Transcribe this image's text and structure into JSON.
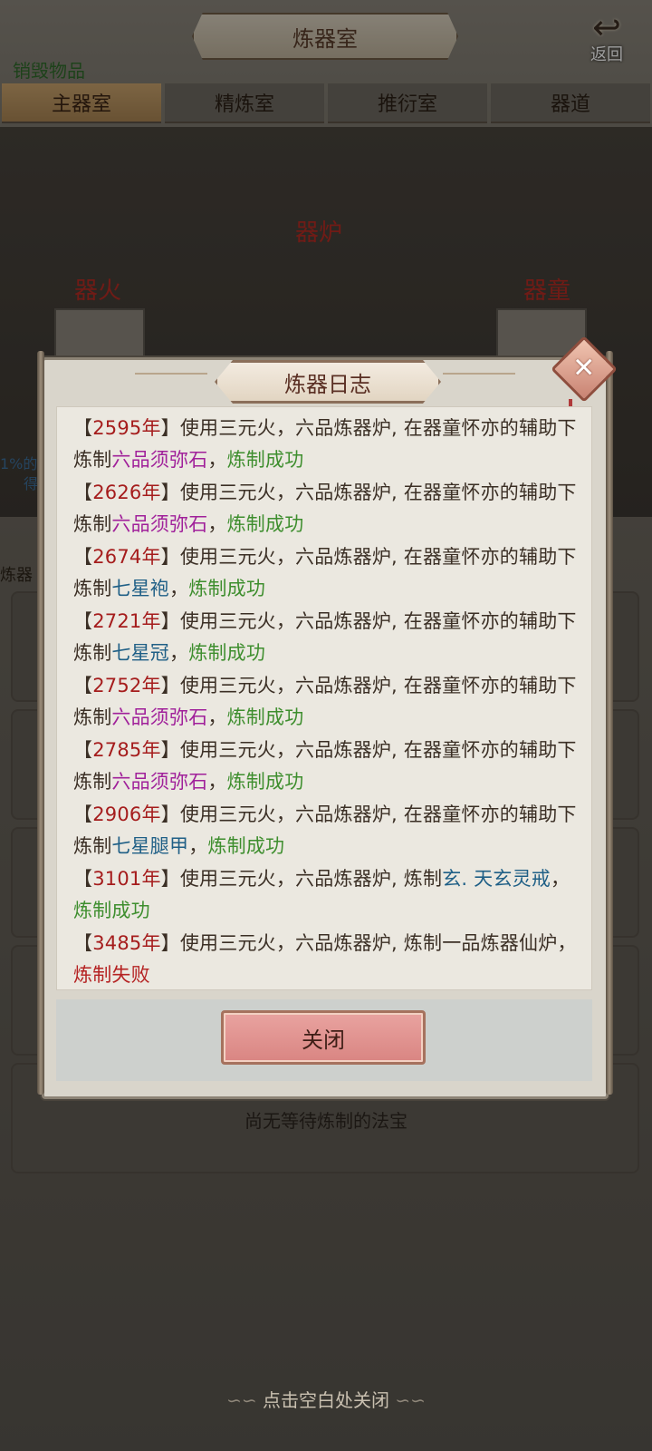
{
  "header": {
    "title": "炼器室",
    "back_label": "返回",
    "back_arrow": "↩",
    "destroy_link": "销毁物品"
  },
  "tabs": [
    {
      "label": "主器室",
      "active": true
    },
    {
      "label": "精炼室",
      "active": false
    },
    {
      "label": "推衍室",
      "active": false
    },
    {
      "label": "器道",
      "active": false
    }
  ],
  "stage": {
    "furnace_label": "器炉",
    "fire_label": "器火",
    "servant_label": "器童",
    "side_text": "1%的",
    "side_text2": "得",
    "list_title": "炼器"
  },
  "empty_hint": "尚无等待炼制的法宝",
  "tap_close": "点击空白处关闭",
  "dialog": {
    "title": "炼器日志",
    "close_icon": "✕",
    "close_button": "关闭",
    "entries": [
      {
        "year": "2595年",
        "text": "使用三元火，六品炼器炉, 在器童怀亦的辅助下炼制",
        "item": "六品须弥石",
        "item_color": "purple",
        "result": "炼制成功",
        "result_type": "success"
      },
      {
        "year": "2626年",
        "text": "使用三元火，六品炼器炉, 在器童怀亦的辅助下炼制",
        "item": "六品须弥石",
        "item_color": "purple",
        "result": "炼制成功",
        "result_type": "success"
      },
      {
        "year": "2674年",
        "text": "使用三元火，六品炼器炉, 在器童怀亦的辅助下炼制",
        "item": "七星袍",
        "item_color": "blue",
        "result": "炼制成功",
        "result_type": "success"
      },
      {
        "year": "2721年",
        "text": "使用三元火，六品炼器炉, 在器童怀亦的辅助下炼制",
        "item": "七星冠",
        "item_color": "blue",
        "result": "炼制成功",
        "result_type": "success"
      },
      {
        "year": "2752年",
        "text": "使用三元火，六品炼器炉, 在器童怀亦的辅助下炼制",
        "item": "六品须弥石",
        "item_color": "purple",
        "result": "炼制成功",
        "result_type": "success"
      },
      {
        "year": "2785年",
        "text": "使用三元火，六品炼器炉, 在器童怀亦的辅助下炼制",
        "item": "六品须弥石",
        "item_color": "purple",
        "result": "炼制成功",
        "result_type": "success"
      },
      {
        "year": "2906年",
        "text": "使用三元火，六品炼器炉, 在器童怀亦的辅助下炼制",
        "item": "七星腿甲",
        "item_color": "blue",
        "result": "炼制成功",
        "result_type": "success"
      },
      {
        "year": "3101年",
        "text": "使用三元火，六品炼器炉, 炼制",
        "item": "玄. 天玄灵戒",
        "item_color": "blue",
        "result": "炼制成功",
        "result_type": "success"
      },
      {
        "year": "3485年",
        "text": "使用三元火，六品炼器炉, 炼制一品炼器仙炉",
        "item": "",
        "item_color": "none",
        "result": "炼制失败",
        "result_type": "fail"
      }
    ]
  }
}
